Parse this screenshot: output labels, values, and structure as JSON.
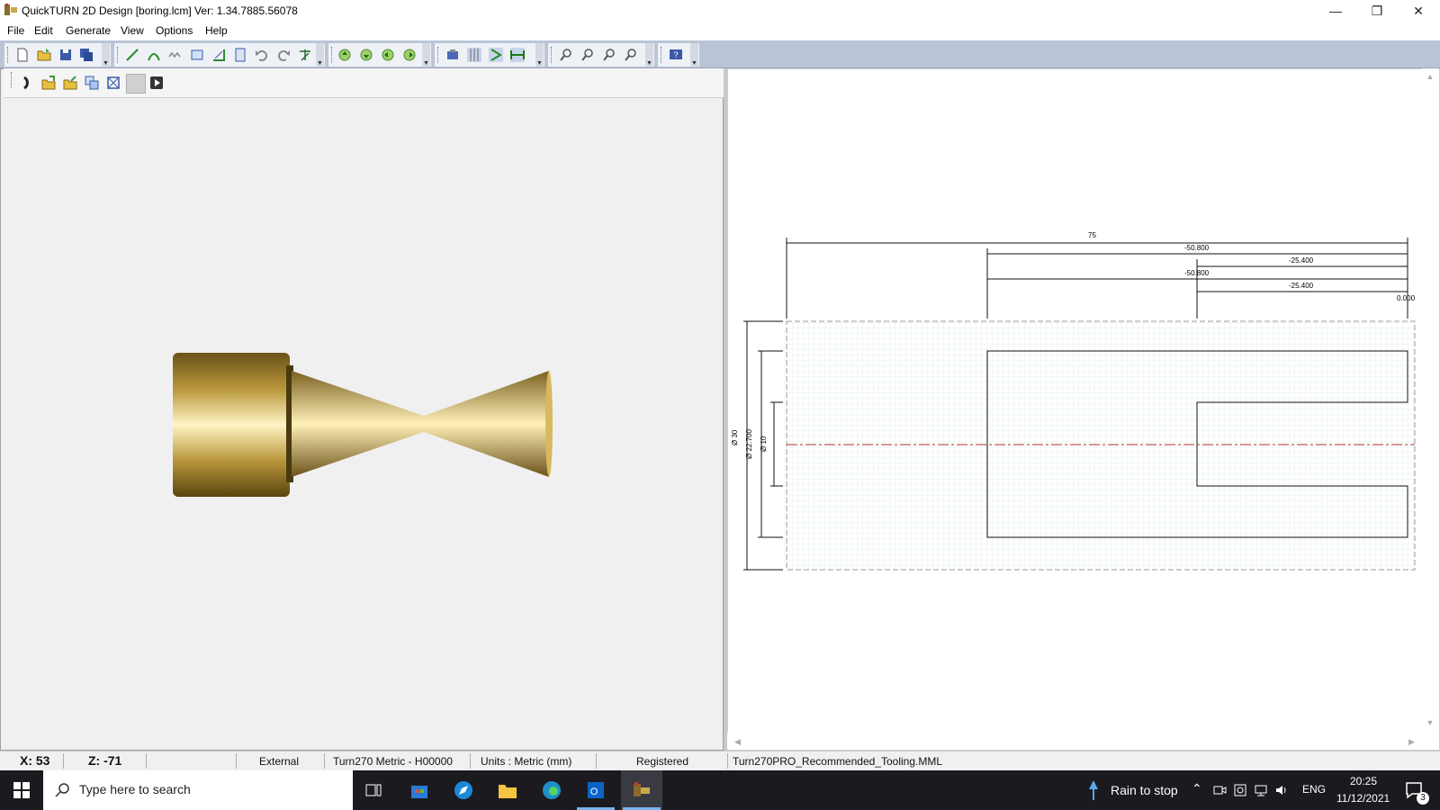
{
  "window": {
    "title": "QuickTURN 2D Design [boring.lcm] Ver: 1.34.7885.56078",
    "controls": [
      "minimize-icon",
      "restore-icon",
      "close-icon"
    ]
  },
  "menu": {
    "items": [
      "File",
      "Edit",
      "Generate",
      "View",
      "Options",
      "Help"
    ]
  },
  "drawing": {
    "dim_top_overall": "75",
    "dim_top_2": "-50.800",
    "dim_top_3": "-25.400",
    "dim_top_4": "-50.800",
    "dim_top_5": "-25.400",
    "dim_top_zero": "0.000",
    "dim_dia_1": "Ø 30",
    "dim_dia_2": "Ø 22.700",
    "dim_dia_3": "Ø 10"
  },
  "status": {
    "x": "X: 53",
    "z": "Z: -71",
    "mode": "External",
    "machine": "Turn270 Metric - H00000",
    "units": "Units : Metric (mm)",
    "license": "Registered",
    "tooling": "Turn270PRO_Recommended_Tooling.MML"
  },
  "taskbar": {
    "search_placeholder": "Type here to search",
    "weather": "Rain to stop",
    "language": "ENG",
    "time": "20:25",
    "date": "11/12/2021",
    "notification_count": "3"
  },
  "colors": {
    "toolbar_bg": "#b9c4d8",
    "part_gold": "#c9a84a",
    "grid_green": "#cfe8d6",
    "centerline_red": "#b03030"
  }
}
